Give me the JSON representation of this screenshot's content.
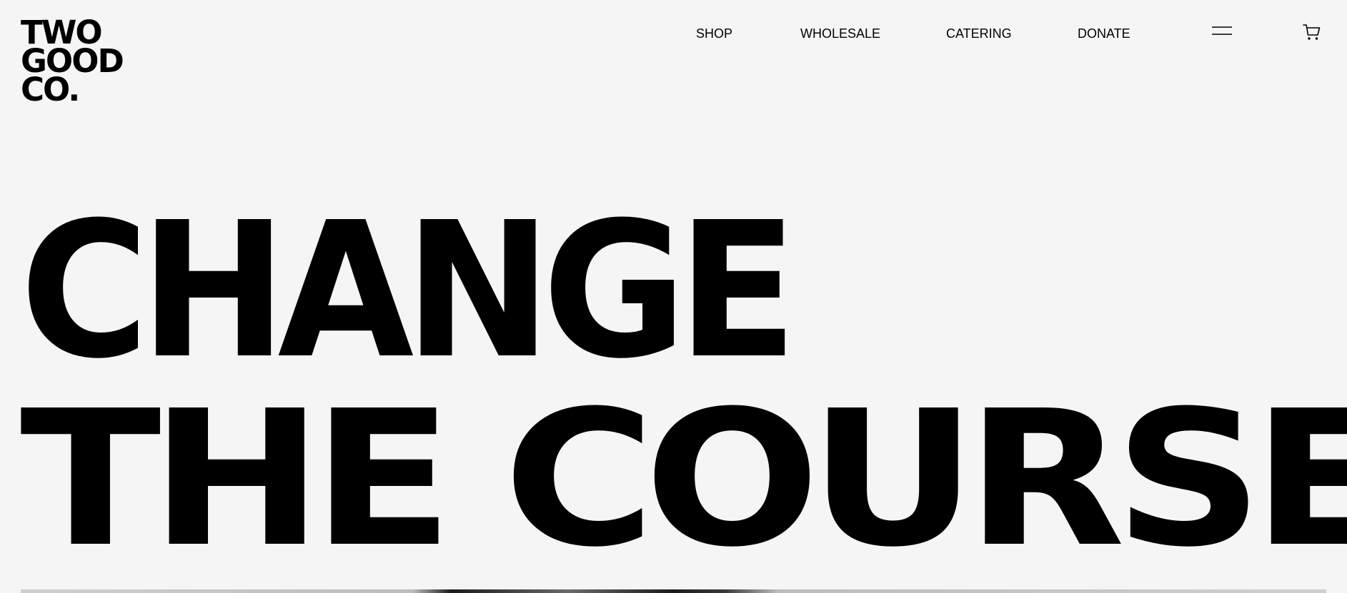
{
  "logo": {
    "line1": "TWO",
    "line2": "GOOD",
    "line3": "CO."
  },
  "nav": {
    "shop": "SHOP",
    "wholesale": "WHOLESALE",
    "catering": "CATERING",
    "donate": "DONATE"
  },
  "icons": {
    "menu": "hamburger-menu-icon",
    "cart": "cart-icon"
  },
  "hero": {
    "line1": "CHANGE",
    "line2": "THE COURSE"
  },
  "colors": {
    "background": "#f5f5f5",
    "text": "#000000"
  }
}
